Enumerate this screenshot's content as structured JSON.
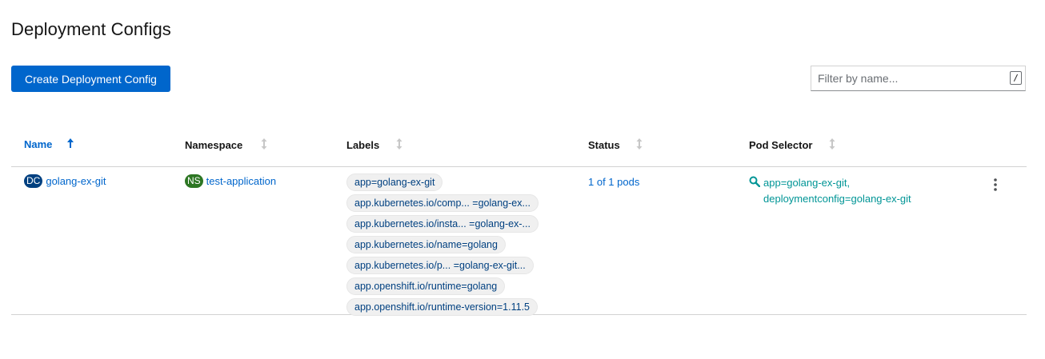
{
  "page": {
    "title": "Deployment Configs"
  },
  "toolbar": {
    "create_label": "Create Deployment Config",
    "filter_placeholder": "Filter by name...",
    "filter_shortcut": "/"
  },
  "table": {
    "columns": [
      {
        "label": "Name",
        "sorted": "asc"
      },
      {
        "label": "Namespace"
      },
      {
        "label": "Labels"
      },
      {
        "label": "Status"
      },
      {
        "label": "Pod Selector"
      }
    ],
    "rows": [
      {
        "name_badge": "DC",
        "name": "golang-ex-git",
        "namespace_badge": "NS",
        "namespace": "test-application",
        "labels": [
          "app=golang-ex-git",
          "app.kubernetes.io/comp... =golang-ex...",
          "app.kubernetes.io/insta... =golang-ex-...",
          "app.kubernetes.io/name=golang",
          "app.kubernetes.io/p...  =golang-ex-git...",
          "app.openshift.io/runtime=golang",
          "app.openshift.io/runtime-version=1.11.5"
        ],
        "status": "1 of 1 pods",
        "pod_selector": "app=golang-ex-git, deploymentconfig=golang-ex-git"
      }
    ]
  },
  "icons": {
    "sort_active": "arrow-up-icon",
    "sort_inactive": "sort-icon",
    "selector": "search-icon",
    "row_actions": "kebab-icon"
  },
  "colors": {
    "primary": "#0066cc",
    "dc_badge": "#004080",
    "ns_badge": "#2d7623",
    "selector_text": "#009596"
  }
}
